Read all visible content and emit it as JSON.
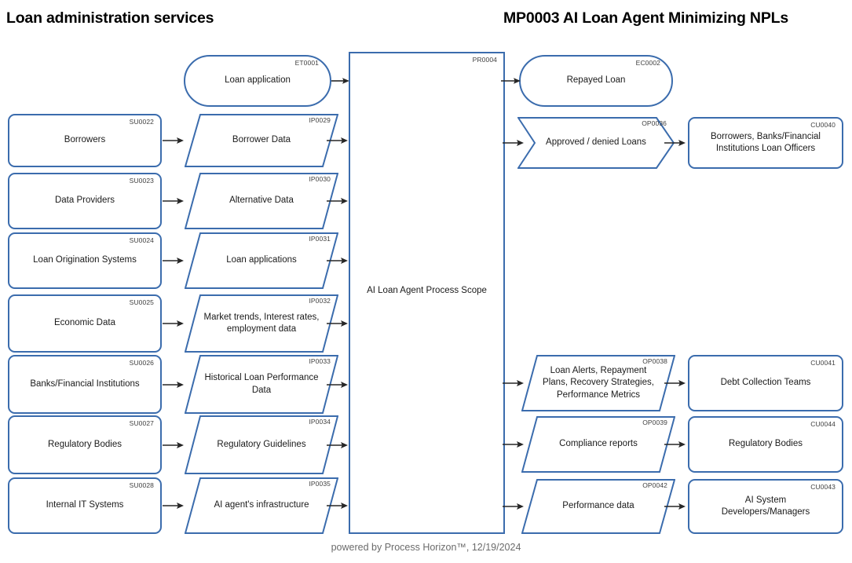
{
  "header": {
    "left_title": "Loan administration services",
    "right_title": "MP0003 AI Loan Agent Minimizing NPLs"
  },
  "footer": {
    "text": "powered by Process Horizon™, 12/19/2024"
  },
  "colors": {
    "shape_border": "#3b6cad",
    "shape_fill": "#ffffff",
    "code_text": "#3f3f3f",
    "label_text": "#1a1a1a",
    "arrow": "#262626",
    "footer_text": "#6b6b6b",
    "header_text": "#000000",
    "background": "#ffffff"
  },
  "process": {
    "code": "PR0004",
    "label": "AI Loan Agent Process Scope"
  },
  "trigger": {
    "code": "ET0001",
    "label": "Loan application"
  },
  "end_event": {
    "code": "EC0002",
    "label": "Repayed Loan"
  },
  "suppliers": [
    {
      "code": "SU0022",
      "label": "Borrowers"
    },
    {
      "code": "SU0023",
      "label": "Data Providers"
    },
    {
      "code": "SU0024",
      "label": "Loan Origination Systems"
    },
    {
      "code": "SU0025",
      "label": "Economic Data"
    },
    {
      "code": "SU0026",
      "label": "Banks/Financial Institutions"
    },
    {
      "code": "SU0027",
      "label": "Regulatory Bodies"
    },
    {
      "code": "SU0028",
      "label": "Internal IT Systems"
    }
  ],
  "inputs": [
    {
      "code": "IP0029",
      "label": "Borrower Data"
    },
    {
      "code": "IP0030",
      "label": "Alternative Data"
    },
    {
      "code": "IP0031",
      "label": "Loan applications"
    },
    {
      "code": "IP0032",
      "label": "Market trends, Interest rates,\nemployment data"
    },
    {
      "code": "IP0033",
      "label": "Historical Loan Performance\nData"
    },
    {
      "code": "IP0034",
      "label": "Regulatory Guidelines"
    },
    {
      "code": "IP0035",
      "label": "AI agent's infrastructure"
    }
  ],
  "outputs": [
    {
      "code": "OP0036",
      "label": "Approved / denied Loans",
      "shape": "chevron"
    },
    {
      "code": "OP0038",
      "label": "Loan Alerts, Repayment\nPlans, Recovery Strategies,\nPerformance Metrics",
      "shape": "parallelogram"
    },
    {
      "code": "OP0039",
      "label": "Compliance reports",
      "shape": "parallelogram"
    },
    {
      "code": "OP0042",
      "label": "Performance data",
      "shape": "parallelogram"
    }
  ],
  "customers": [
    {
      "code": "CU0040",
      "label": "Borrowers, Banks/Financial\nInstitutions Loan Officers"
    },
    {
      "code": "CU0041",
      "label": "Debt Collection Teams"
    },
    {
      "code": "CU0044",
      "label": "Regulatory Bodies"
    },
    {
      "code": "CU0043",
      "label": "AI System Developers/Managers"
    }
  ]
}
